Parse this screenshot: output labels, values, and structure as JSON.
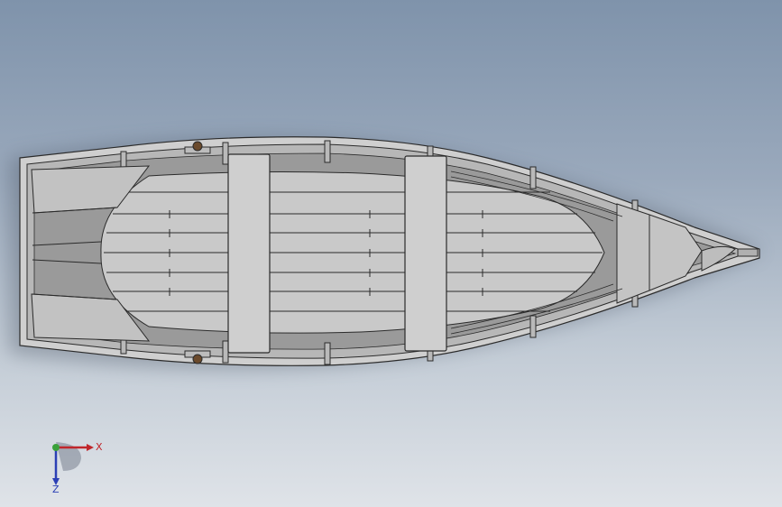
{
  "viewport": {
    "background_top": "#7f93ab",
    "background_bottom": "#dfe3e8"
  },
  "model": {
    "hull_color": "#c8c8c8",
    "interior_color": "#a9a9a9",
    "edge_color": "#2b2b2b",
    "hardware_color": "#6b4a2c"
  },
  "triad": {
    "x_label": "X",
    "z_label": "Z",
    "x_color": "#c0262b",
    "y_color": "#3aa13a",
    "z_color": "#2b3fb5"
  }
}
